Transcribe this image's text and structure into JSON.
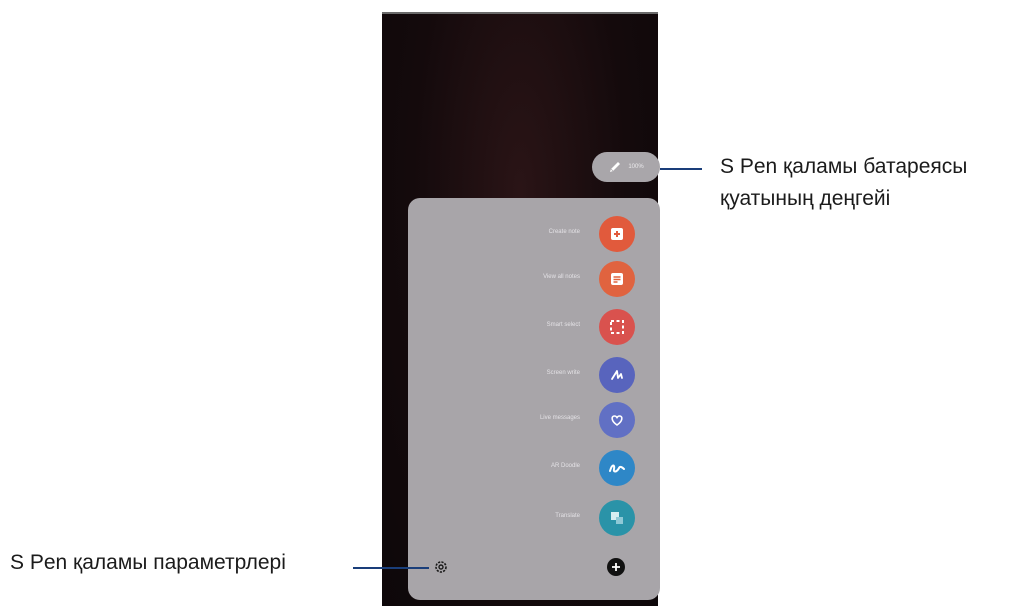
{
  "callouts": {
    "battery_line1": "S Pen қаламы батареясы",
    "battery_line2": "қуатының деңгейі",
    "settings": "S Pen қаламы параметрлері"
  },
  "battery_pill": {
    "icon": "pen-icon",
    "percent": "100%"
  },
  "menu": {
    "items": [
      {
        "label": "Create note",
        "icon": "create-note-icon",
        "color": "#e15a3c"
      },
      {
        "label": "View all notes",
        "icon": "view-notes-icon",
        "color": "#e0633f"
      },
      {
        "label": "Smart select",
        "icon": "smart-select-icon",
        "color": "#d9524e"
      },
      {
        "label": "Screen write",
        "icon": "screen-write-icon",
        "color": "#5864bd"
      },
      {
        "label": "Live messages",
        "icon": "live-messages-icon",
        "color": "#6170c4"
      },
      {
        "label": "AR Doodle",
        "icon": "ar-doodle-icon",
        "color": "#2e87c7"
      },
      {
        "label": "Translate",
        "icon": "translate-icon",
        "color": "#2a93a8"
      }
    ],
    "settings_icon": "gear-icon",
    "add_icon": "add-icon"
  }
}
